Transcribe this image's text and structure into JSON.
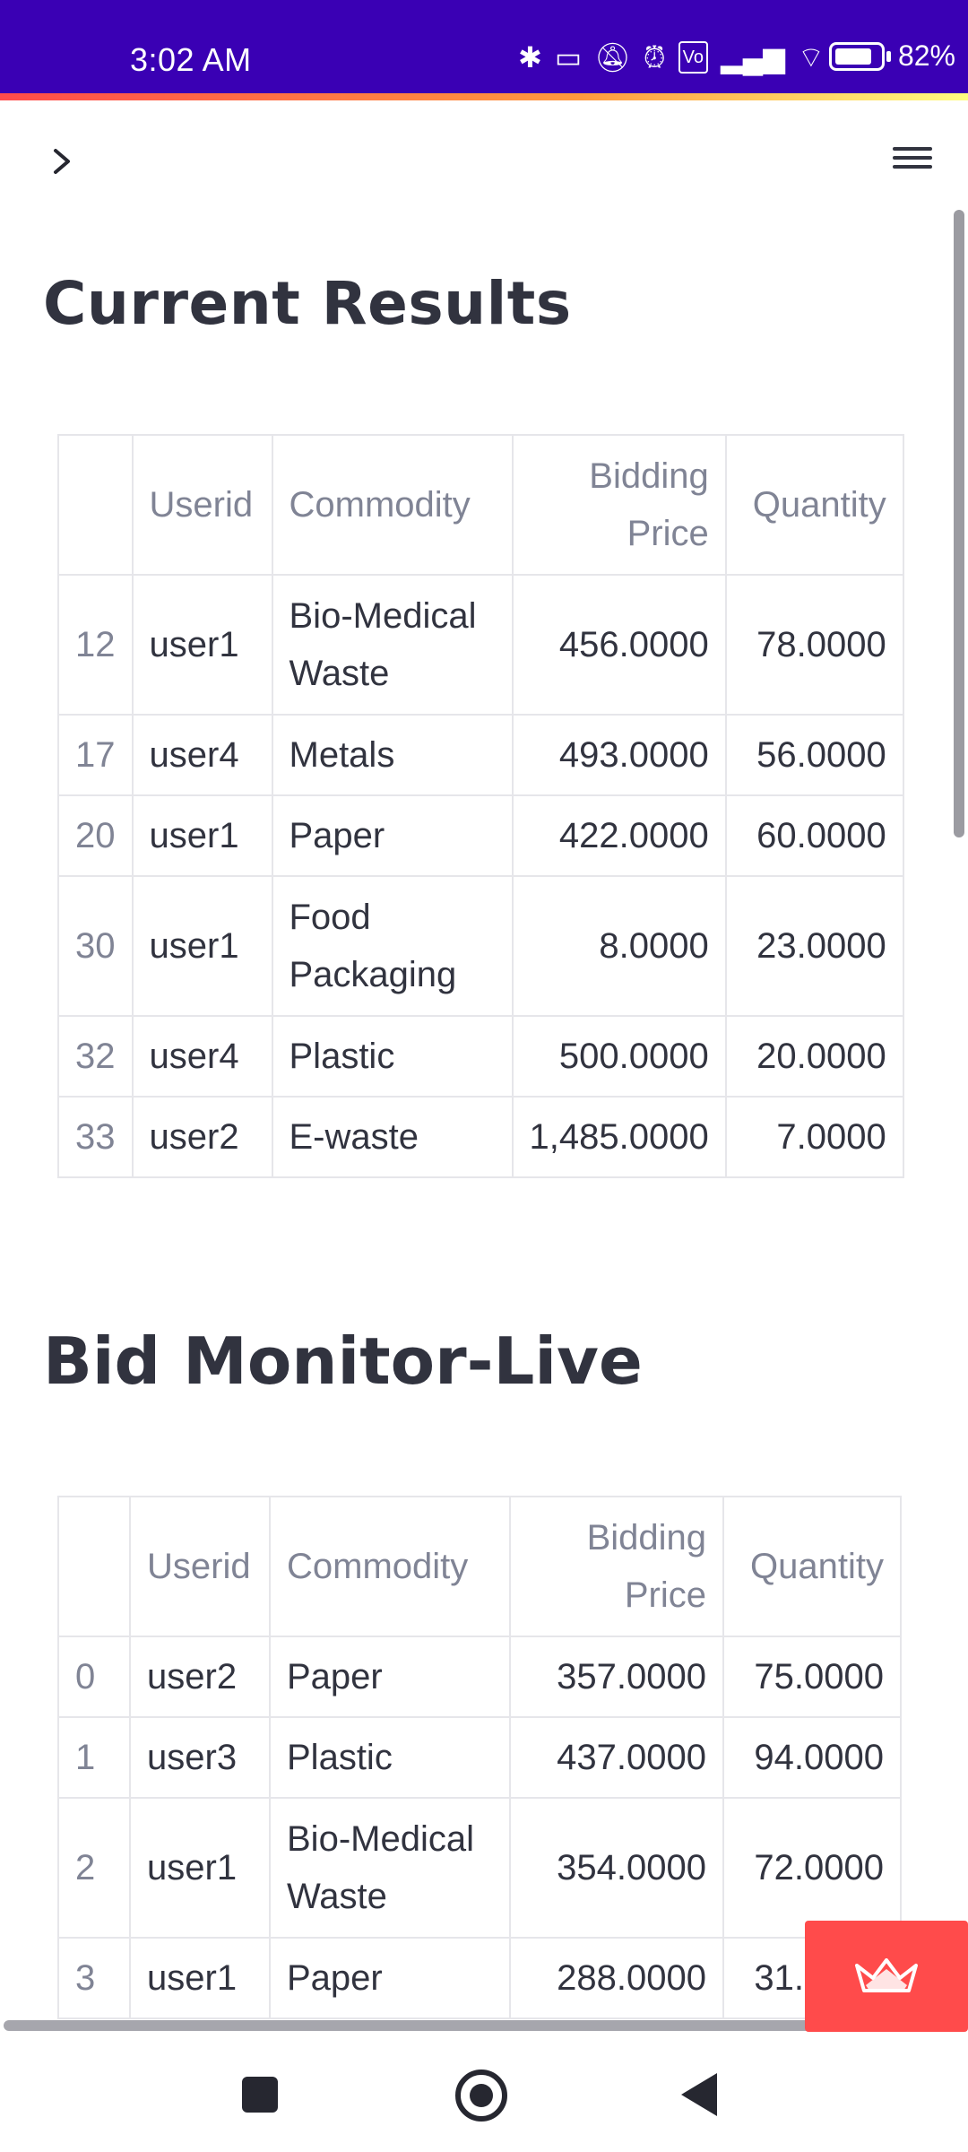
{
  "status_bar": {
    "time": "3:02 AM",
    "battery": "82%",
    "icons": [
      "bluetooth-icon",
      "vibrate-icon",
      "mute-icon",
      "alarm-icon",
      "volte-icon",
      "signal-icon",
      "wifi-icon",
      "battery-icon"
    ]
  },
  "app_bar": {
    "sidebar_toggle_icon": "chevron-right-icon",
    "menu_icon": "hamburger-menu-icon"
  },
  "sections": {
    "current": {
      "title": "Current Results",
      "headers": [
        "",
        "Userid",
        "Commodity",
        "Bidding Price",
        "Quantity"
      ],
      "rows": [
        {
          "idx": "12",
          "user": "user1",
          "commodity": "Bio-Medical Waste",
          "price": "456.0000",
          "qty": "78.0000"
        },
        {
          "idx": "17",
          "user": "user4",
          "commodity": "Metals",
          "price": "493.0000",
          "qty": "56.0000"
        },
        {
          "idx": "20",
          "user": "user1",
          "commodity": "Paper",
          "price": "422.0000",
          "qty": "60.0000"
        },
        {
          "idx": "30",
          "user": "user1",
          "commodity": "Food Packaging",
          "price": "8.0000",
          "qty": "23.0000"
        },
        {
          "idx": "32",
          "user": "user4",
          "commodity": "Plastic",
          "price": "500.0000",
          "qty": "20.0000"
        },
        {
          "idx": "33",
          "user": "user2",
          "commodity": "E-waste",
          "price": "1,485.0000",
          "qty": "7.0000"
        }
      ]
    },
    "bid": {
      "title": "Bid Monitor-Live",
      "headers": [
        "",
        "Userid",
        "Commodity",
        "Bidding Price",
        "Quantity"
      ],
      "rows": [
        {
          "idx": "0",
          "user": "user2",
          "commodity": "Paper",
          "price": "357.0000",
          "qty": "75.0000"
        },
        {
          "idx": "1",
          "user": "user3",
          "commodity": "Plastic",
          "price": "437.0000",
          "qty": "94.0000"
        },
        {
          "idx": "2",
          "user": "user1",
          "commodity": "Bio-Medical Waste",
          "price": "354.0000",
          "qty": "72.0000"
        },
        {
          "idx": "3",
          "user": "user1",
          "commodity": "Paper",
          "price": "288.0000",
          "qty": "31.0000"
        }
      ]
    }
  },
  "fab": {
    "icon": "streamlit-crown-icon",
    "color": "#ff4b4b"
  },
  "nav_bar": {
    "icons": [
      "recents-square-icon",
      "home-circle-icon",
      "back-triangle-icon"
    ]
  },
  "colors": {
    "status_bar": "#3a00b4",
    "accent": "#ff4b4b",
    "text": "#31333f",
    "muted": "#808495"
  }
}
